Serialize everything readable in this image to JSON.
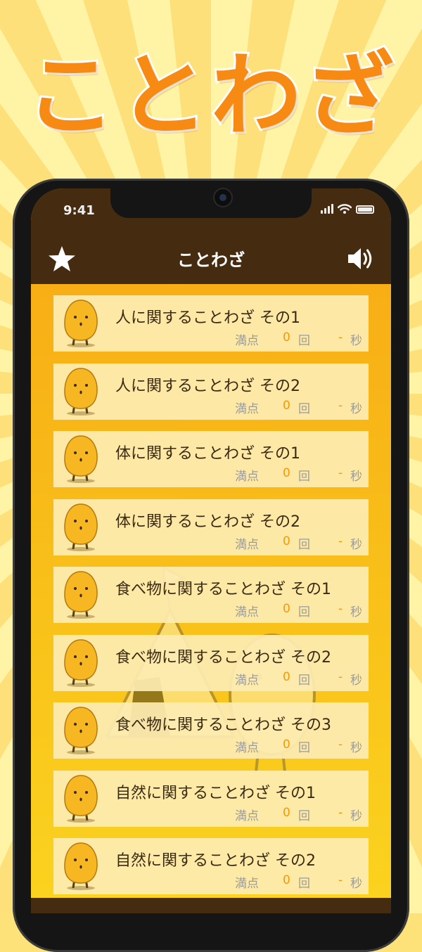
{
  "promo": {
    "title": "ことわざ"
  },
  "status_bar": {
    "time": "9:41"
  },
  "nav": {
    "title": "ことわざ",
    "favorites_icon": "star-icon",
    "sound_icon": "speaker-icon"
  },
  "colors": {
    "accent": "#f68a12",
    "bar": "#452b0f",
    "highlight": "#f5990a"
  },
  "quizzes": [
    {
      "title": "人に関することわざ その1",
      "score_label": "満点",
      "count": "0",
      "count_unit": "回",
      "time": "-",
      "time_unit": "秒"
    },
    {
      "title": "人に関することわざ その2",
      "score_label": "満点",
      "count": "0",
      "count_unit": "回",
      "time": "-",
      "time_unit": "秒"
    },
    {
      "title": "体に関することわざ その1",
      "score_label": "満点",
      "count": "0",
      "count_unit": "回",
      "time": "-",
      "time_unit": "秒"
    },
    {
      "title": "体に関することわざ その2",
      "score_label": "満点",
      "count": "0",
      "count_unit": "回",
      "time": "-",
      "time_unit": "秒"
    },
    {
      "title": "食べ物に関することわざ その1",
      "score_label": "満点",
      "count": "0",
      "count_unit": "回",
      "time": "-",
      "time_unit": "秒"
    },
    {
      "title": "食べ物に関することわざ その2",
      "score_label": "満点",
      "count": "0",
      "count_unit": "回",
      "time": "-",
      "time_unit": "秒"
    },
    {
      "title": "食べ物に関することわざ その3",
      "score_label": "満点",
      "count": "0",
      "count_unit": "回",
      "time": "-",
      "time_unit": "秒"
    },
    {
      "title": "自然に関することわざ その1",
      "score_label": "満点",
      "count": "0",
      "count_unit": "回",
      "time": "-",
      "time_unit": "秒"
    },
    {
      "title": "自然に関することわざ その2",
      "score_label": "満点",
      "count": "0",
      "count_unit": "回",
      "time": "-",
      "time_unit": "秒"
    }
  ]
}
